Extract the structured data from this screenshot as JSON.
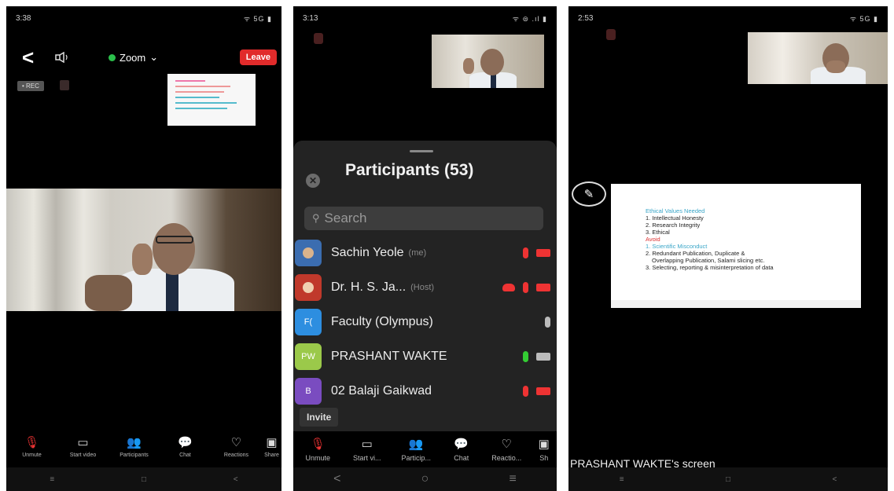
{
  "screen1": {
    "status_time": "3:38",
    "status_icons": "ᯤ 5G ▮",
    "back_label": "<",
    "title": "Zoom",
    "leave_label": "Leave",
    "rec_label": "• REC",
    "toolbar": [
      "Unmute",
      "Start video",
      "Participants",
      "Chat",
      "Reactions",
      "Share"
    ],
    "nav": [
      "≡",
      "□",
      "<"
    ]
  },
  "screen2": {
    "status_time": "3:13",
    "status_icons": "ᯤ ⊜ .ıl ▮",
    "panel_title": "Participants (53)",
    "close_label": "✕",
    "search_placeholder": "Search",
    "participants": [
      {
        "initials": "",
        "name": "Sachin Yeole",
        "role": "(me)",
        "avatar_color": "#3b6db0"
      },
      {
        "initials": "",
        "name": "Dr. H. S. Ja...",
        "role": "(Host)",
        "avatar_color": "#c0392b"
      },
      {
        "initials": "F(",
        "name": "Faculty (Olympus)",
        "role": "",
        "avatar_color": "#2d8ee0"
      },
      {
        "initials": "PW",
        "name": "PRASHANT WAKTE",
        "role": "",
        "avatar_color": "#9bc94a"
      },
      {
        "initials": "B",
        "name": "02 Balaji Gaikwad",
        "role": "",
        "avatar_color": "#7a4cc0"
      }
    ],
    "invite_label": "Invite",
    "toolbar": [
      "Unmute",
      "Start vi...",
      "Particip...",
      "Chat",
      "Reactio...",
      "Sh"
    ],
    "participants_count": "53",
    "nav": [
      "<",
      "○",
      "≡"
    ]
  },
  "screen3": {
    "status_time": "2:53",
    "status_icons": "ᯤ 5G ▮",
    "slide": {
      "heading": "Ethical Values Needed",
      "items": [
        "1. Intellectual Honesty",
        "2. Research Integrity",
        "3. Ethical"
      ],
      "avoid": "Avoid",
      "avoid_items": [
        "1. Scientific Misconduct",
        "2. Redundant Publication, Duplicate &",
        "   Overlapping Publication, Salami slicing etc.",
        "3. Selecting, reporting & misinterpretation of data"
      ]
    },
    "screen_owner_label": "PRASHANT WAKTE's screen",
    "nav": [
      "≡",
      "□",
      "<"
    ]
  },
  "colors": {
    "accent_red": "#e12b2b",
    "zoom_green": "#2bbf4b",
    "slide_heading": "#3aa6c8"
  }
}
